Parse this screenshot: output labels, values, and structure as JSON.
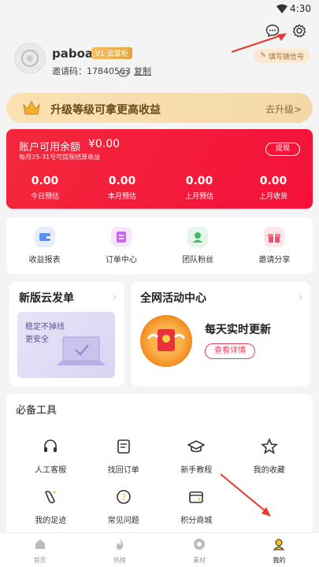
{
  "status": {
    "time": "4:30"
  },
  "profile": {
    "username": "paboa",
    "vip_badge": "V1 云掌柜",
    "invite_label": "邀请码：17840563",
    "copy_label": "复制",
    "wechat_button": "填写微信号"
  },
  "upgrade": {
    "text": "升级等级可拿更高收益",
    "link": "去升级>"
  },
  "balance": {
    "label": "账户可用余额",
    "amount": "¥0.00",
    "note": "每月25-31号可提现结算收益",
    "withdraw": "提现",
    "stats": [
      {
        "value": "0.00",
        "label": "今日预估"
      },
      {
        "value": "0.00",
        "label": "本月预估"
      },
      {
        "value": "0.00",
        "label": "上月预估"
      },
      {
        "value": "0.00",
        "label": "上月收货"
      }
    ]
  },
  "quick": [
    {
      "label": "收益报表",
      "icon": "wallet-icon",
      "color": "#5b8ef0"
    },
    {
      "label": "订单中心",
      "icon": "order-icon",
      "color": "#c86af0"
    },
    {
      "label": "团队粉丝",
      "icon": "team-icon",
      "color": "#43b96a"
    },
    {
      "label": "邀请分享",
      "icon": "gift-icon",
      "color": "#f0506e"
    }
  ],
  "cloud": {
    "title": "新版云发单",
    "line1": "稳定不掉线",
    "line2": "更安全"
  },
  "activity": {
    "title": "全网活动中心",
    "text": "每天实时更新",
    "button": "查看详情"
  },
  "tools": {
    "title": "必备工具",
    "items": [
      {
        "label": "人工客服",
        "icon": "headset-icon"
      },
      {
        "label": "找回订单",
        "icon": "find-order-icon"
      },
      {
        "label": "新手教程",
        "icon": "graduation-cap-icon"
      },
      {
        "label": "我的收藏",
        "icon": "star-icon"
      },
      {
        "label": "我的足迹",
        "icon": "footprint-icon"
      },
      {
        "label": "常见问题",
        "icon": "question-icon"
      },
      {
        "label": "积分商城",
        "icon": "points-store-icon"
      }
    ]
  },
  "nav": [
    {
      "label": "首页",
      "icon": "home-icon"
    },
    {
      "label": "热榜",
      "icon": "fire-icon"
    },
    {
      "label": "素材",
      "icon": "material-icon"
    },
    {
      "label": "我的",
      "icon": "profile-icon",
      "active": true
    }
  ],
  "colors": {
    "accent": "#f3283b",
    "gold": "#f4d9a8",
    "nav_active": "#f5c518"
  }
}
